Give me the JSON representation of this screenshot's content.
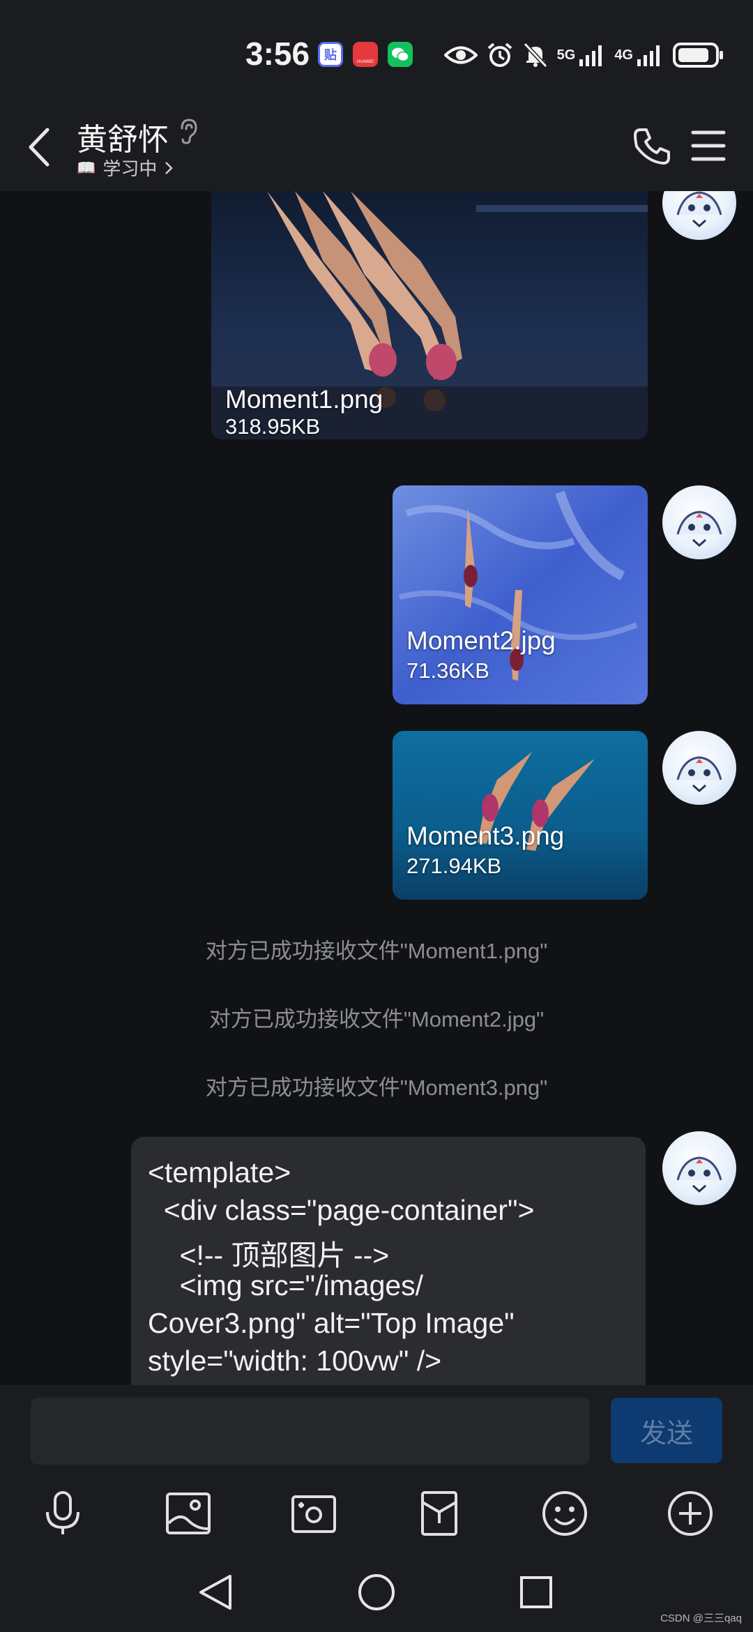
{
  "status_bar": {
    "time": "3:56",
    "apps": [
      {
        "name": "tieba-app-icon",
        "label": "贴",
        "color": "#5c6cf0"
      },
      {
        "name": "huawei-app-icon",
        "label": "HUAWEI",
        "color": "#e6393d"
      },
      {
        "name": "wechat-app-icon",
        "label": "",
        "color": "#13c15c"
      }
    ],
    "network_5g": "5G",
    "network_4g": "4G",
    "battery_level": 0.85
  },
  "header": {
    "contact_name": "黄舒怀",
    "status_emoji": "📖",
    "status_text": "学习中"
  },
  "messages": {
    "files": [
      {
        "name": "Moment1.png",
        "size": "318.95KB"
      },
      {
        "name": "Moment2.jpg",
        "size": "71.36KB"
      },
      {
        "name": "Moment3.png",
        "size": "271.94KB"
      }
    ],
    "system": [
      "对方已成功接收文件\"Moment1.png\"",
      "对方已成功接收文件\"Moment2.jpg\"",
      "对方已成功接收文件\"Moment3.png\""
    ],
    "code_lines": [
      "<template>",
      "  <div class=\"page-container\">",
      "    <!-- 顶部图片 -->",
      "    <img src=\"/images/",
      "Cover3.png\" alt=\"Top Image\"",
      "style=\"width: 100vw\" />"
    ]
  },
  "input": {
    "value": "",
    "send_label": "发送"
  },
  "watermark": "CSDN @三三qaq"
}
